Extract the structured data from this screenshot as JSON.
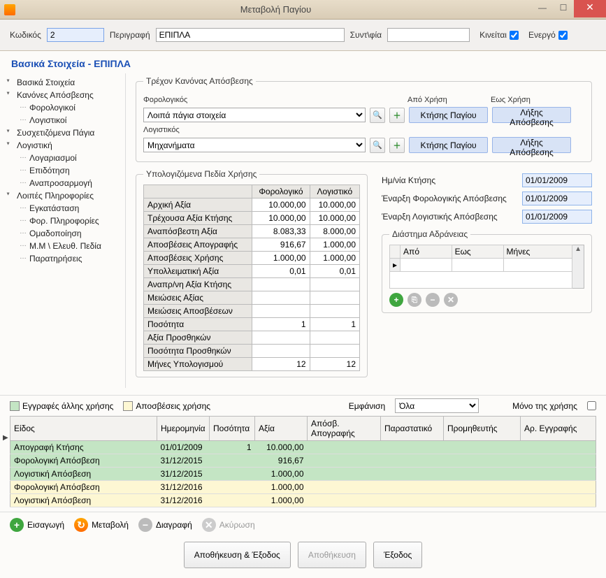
{
  "window": {
    "title": "Μεταβολή Παγίου"
  },
  "toprow": {
    "code_label": "Κωδικός",
    "code_value": "2",
    "desc_label": "Περιγραφή",
    "desc_value": "ΕΠΙΠΛΑ",
    "sub_label": "Συντ\\φία",
    "sub_value": "",
    "moves_label": "Κινείται",
    "active_label": "Ενεργό"
  },
  "heading": "Βασικά Στοιχεία - ΕΠΙΠΛΑ",
  "tree": [
    {
      "label": "Βασικά Στοιχεία",
      "lvl": 1
    },
    {
      "label": "Κανόνες Απόσβεσης",
      "lvl": 1
    },
    {
      "label": "Φορολογικοί",
      "lvl": 2
    },
    {
      "label": "Λογιστικοί",
      "lvl": 2
    },
    {
      "label": "Συσχετιζόμενα Πάγια",
      "lvl": 1
    },
    {
      "label": "Λογιστική",
      "lvl": 1
    },
    {
      "label": "Λογαριασμοί",
      "lvl": 2
    },
    {
      "label": "Επιδότηση",
      "lvl": 2
    },
    {
      "label": "Αναπροσαρμογή",
      "lvl": 2
    },
    {
      "label": "Λοιπές Πληροφορίες",
      "lvl": 1
    },
    {
      "label": "Εγκατάσταση",
      "lvl": 2
    },
    {
      "label": "Φορ. Πληροφορίες",
      "lvl": 2
    },
    {
      "label": "Ομαδοποίηση",
      "lvl": 2
    },
    {
      "label": "Μ.Μ \\ Ελευθ. Πεδία",
      "lvl": 2
    },
    {
      "label": "Παρατηρήσεις",
      "lvl": 2
    }
  ],
  "rule": {
    "legend": "Τρέχον Κανόνας Απόσβεσης",
    "tax_label": "Φορολογικός",
    "tax_value": "Λοιπά πάγια στοιχεία",
    "acc_label": "Λογιστικός",
    "acc_value": "Μηχανήματα",
    "from_label": "Από Χρήση",
    "to_label": "Εως Χρήση",
    "btn_acq": "Κτήσης Παγίου",
    "btn_end": "Λήξης Απόσβεσης"
  },
  "calc": {
    "legend": "Yπολογιζόμενα Πεδία Χρήσης",
    "col_tax": "Φορολογικό",
    "col_acc": "Λογιστικό",
    "rows": [
      {
        "label": "Αρχική Αξία",
        "tax": "10.000,00",
        "acc": "10.000,00"
      },
      {
        "label": "Τρέχουσα Αξία Κτήσης",
        "tax": "10.000,00",
        "acc": "10.000,00"
      },
      {
        "label": "Αναπόσβεστη Αξία",
        "tax": "8.083,33",
        "acc": "8.000,00"
      },
      {
        "label": "Αποσβέσεις Απογραφής",
        "tax": "916,67",
        "acc": "1.000,00"
      },
      {
        "label": "Αποσβέσεις Χρήσης",
        "tax": "1.000,00",
        "acc": "1.000,00"
      },
      {
        "label": "Υπολλειματική Αξία",
        "tax": "0,01",
        "acc": "0,01"
      },
      {
        "label": "Αναπρ/νη Αξία Κτήσης",
        "tax": "",
        "acc": ""
      },
      {
        "label": "Μειώσεις Αξίας",
        "tax": "",
        "acc": ""
      },
      {
        "label": "Μειώσεις Αποσβέσεων",
        "tax": "",
        "acc": ""
      },
      {
        "label": "Ποσότητα",
        "tax": "1",
        "acc": "1"
      },
      {
        "label": "Αξία Προσθηκών",
        "tax": "",
        "acc": ""
      },
      {
        "label": "Ποσότητα Προσθηκών",
        "tax": "",
        "acc": ""
      },
      {
        "label": "Μήνες Υπολογισμού",
        "tax": "12",
        "acc": "12"
      }
    ]
  },
  "dates": {
    "acq_label": "Ημ/νία Κτήσης",
    "acq_val": "01/01/2009",
    "tax_start_label": "Έναρξη Φορολογικής Απόσβεσης",
    "tax_start_val": "01/01/2009",
    "acc_start_label": "Έναρξη Λογιστικής Απόσβεσης",
    "acc_start_val": "01/01/2009"
  },
  "idle": {
    "legend": "Διάστημα Αδράνειας",
    "h_from": "Από",
    "h_to": "Εως",
    "h_months": "Μήνες"
  },
  "legendrow": {
    "other": "Εγγραφές άλλης χρήσης",
    "depr": "Αποσβέσεις χρήσης",
    "show_label": "Εμφάνιση",
    "show_val": "Όλα",
    "only_label": "Μόνο της χρήσης"
  },
  "grid": {
    "h_type": "Είδος",
    "h_date": "Ημερομηνία",
    "h_qty": "Ποσότητα",
    "h_val": "Αξία",
    "h_inv": "Απόσβ. Απογραφής",
    "h_doc": "Παραστατικό",
    "h_sup": "Προμηθευτής",
    "h_rec": "Αρ. Εγγραφής",
    "rows": [
      {
        "cls": "green",
        "type": "Απογραφή Κτήσης",
        "date": "01/01/2009",
        "qty": "1",
        "val": "10.000,00"
      },
      {
        "cls": "green",
        "type": "Φορολογική Απόσβεση",
        "date": "31/12/2015",
        "qty": "",
        "val": "916,67"
      },
      {
        "cls": "green",
        "type": "Λογιστική Απόσβεση",
        "date": "31/12/2015",
        "qty": "",
        "val": "1.000,00"
      },
      {
        "cls": "yel",
        "type": "Φορολογική Απόσβεση",
        "date": "31/12/2016",
        "qty": "",
        "val": "1.000,00"
      },
      {
        "cls": "yel",
        "type": "Λογιστική Απόσβεση",
        "date": "31/12/2016",
        "qty": "",
        "val": "1.000,00"
      }
    ]
  },
  "toolbar": {
    "insert": "Εισαγωγή",
    "modify": "Μεταβολή",
    "delete": "Διαγραφή",
    "cancel": "Ακύρωση"
  },
  "bottom": {
    "save_exit": "Αποθήκευση & Έξοδος",
    "save": "Αποθήκευση",
    "exit": "Έξοδος"
  }
}
